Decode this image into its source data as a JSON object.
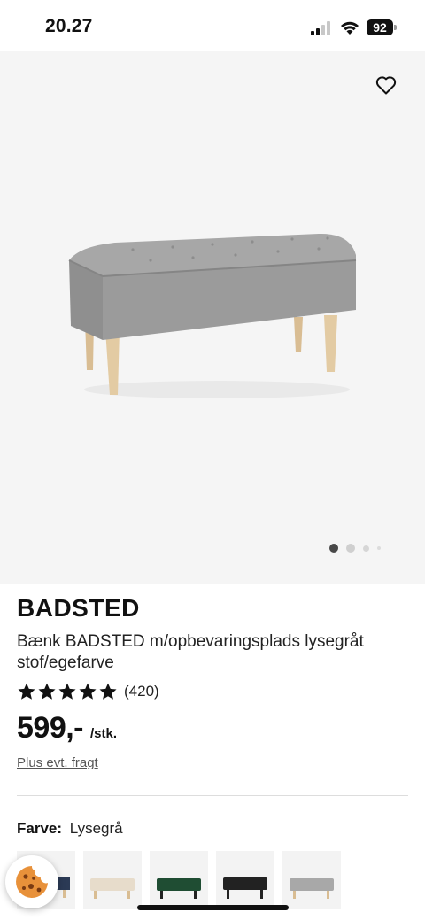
{
  "status_bar": {
    "time": "20.27",
    "battery": "92",
    "icons": [
      "signal-icon",
      "wifi-icon",
      "battery-icon"
    ]
  },
  "gallery": {
    "image_alt": "bench-image",
    "favorite_icon": "heart-icon",
    "page_count": 4,
    "active_page": 1
  },
  "product": {
    "name": "BADSTED",
    "description": "Bænk BADSTED m/opbevaringsplads lysegråt stof/egefarve",
    "rating": 5,
    "review_count": "(420)",
    "price": "599,-",
    "unit": "/stk.",
    "shipping_link": "Plus evt. fragt"
  },
  "color": {
    "label": "Farve:",
    "value": "Lysegrå",
    "swatches": [
      {
        "name": "dark-blue",
        "color": "#2b3a55"
      },
      {
        "name": "beige",
        "color": "#e7dccb"
      },
      {
        "name": "dark-green",
        "color": "#1f4d33"
      },
      {
        "name": "black",
        "color": "#222222"
      },
      {
        "name": "light-grey",
        "color": "#a8a8a8"
      }
    ]
  },
  "colors": {
    "accent": "#111111",
    "gallery_bg": "#f5f5f5",
    "bench_grey": "#9a9a9a",
    "leg_wood": "#e0c79e"
  }
}
